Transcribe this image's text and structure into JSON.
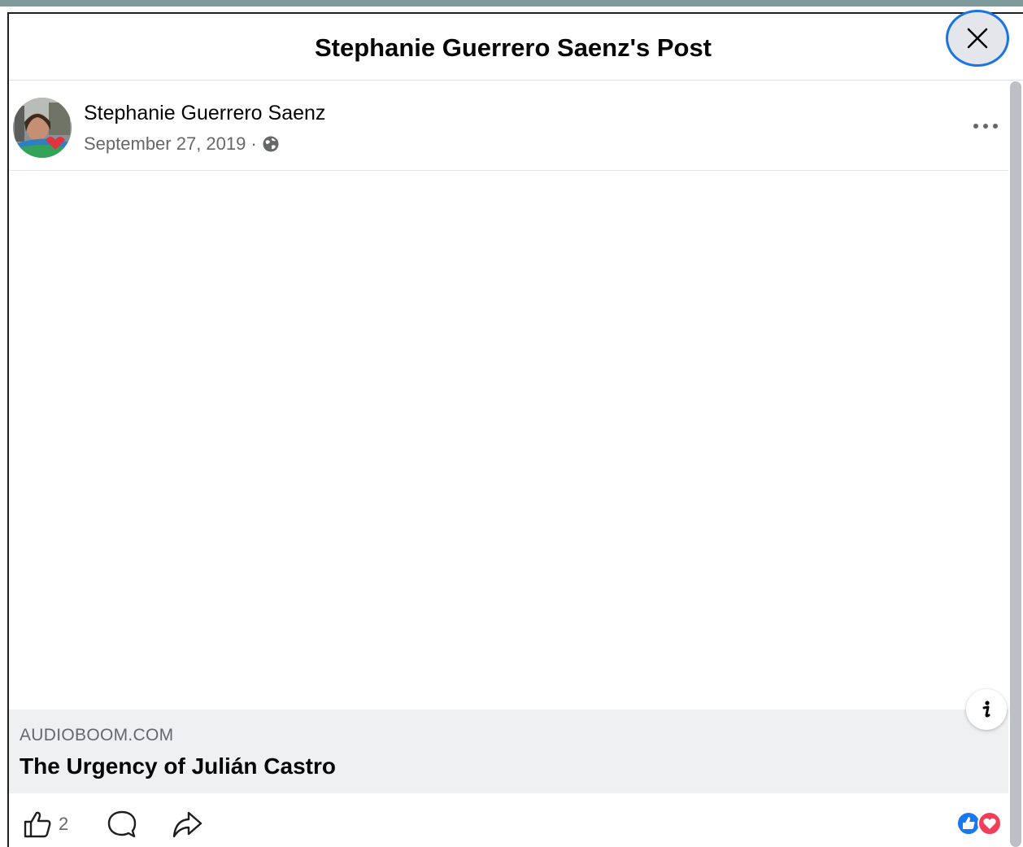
{
  "header": {
    "title": "Stephanie Guerrero Saenz's Post",
    "close_icon": "close-icon"
  },
  "post": {
    "author": "Stephanie Guerrero Saenz",
    "date": "September 27, 2019",
    "separator": "·",
    "audience_icon": "globe-icon",
    "more_icon": "more-options-icon"
  },
  "link_preview": {
    "domain": "AUDIOBOOM.COM",
    "title": "The Urgency of Julián Castro",
    "info_icon": "info-icon"
  },
  "actions": {
    "like_count": "2",
    "reactions": [
      "like",
      "love"
    ]
  },
  "colors": {
    "accent": "#1b74e4",
    "like_blue": "#1877f2",
    "love_red": "#f33e58",
    "preview_bg": "#eef0f1",
    "secondary_text": "#65676b"
  }
}
